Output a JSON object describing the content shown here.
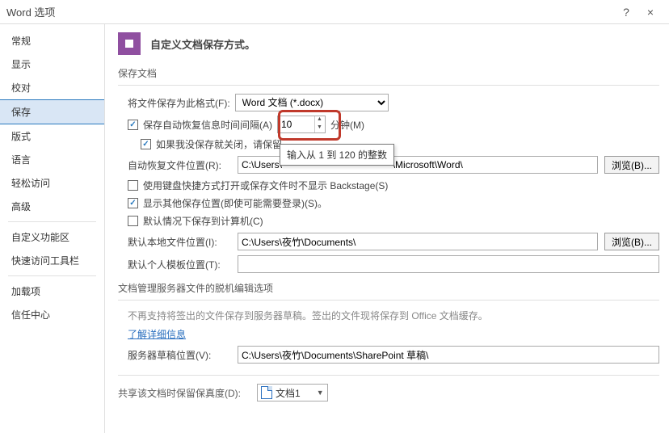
{
  "window": {
    "title": "Word 选项",
    "help": "?",
    "close": "×"
  },
  "sidebar": {
    "items": [
      "常规",
      "显示",
      "校对",
      "保存",
      "版式",
      "语言",
      "轻松访问",
      "高级"
    ],
    "items2": [
      "自定义功能区",
      "快速访问工具栏"
    ],
    "items3": [
      "加载项",
      "信任中心"
    ],
    "selected": "保存"
  },
  "header": {
    "title": "自定义文档保存方式。"
  },
  "section1": {
    "title": "保存文档",
    "format_label": "将文件保存为此格式(F):",
    "format_value": "Word 文档 (*.docx)",
    "autosave_cb_label": "保存自动恢复信息时间间隔(A)",
    "autosave_value": "10",
    "minutes_label": "分钟(M)",
    "keep_last_label": "如果我没保存就关闭，请保留",
    "tooltip": "输入从 1 到 120 的整数",
    "autorecover_label": "自动恢复文件位置(R):",
    "autorecover_path": "C:\\Users\\                                         \\Microsoft\\Word\\",
    "browse": "浏览(B)...",
    "hide_backstage_label": "使用键盘快捷方式打开或保存文件时不显示 Backstage(S)",
    "show_other_label": "显示其他保存位置(即使可能需要登录)(S)。",
    "default_pc_label": "默认情况下保存到计算机(C)",
    "local_label": "默认本地文件位置(I):",
    "local_path": "C:\\Users\\夜竹\\Documents\\",
    "template_label": "默认个人模板位置(T):",
    "template_path": ""
  },
  "section2": {
    "title": "文档管理服务器文件的脱机编辑选项",
    "note": "不再支持将签出的文件保存到服务器草稿。签出的文件现将保存到 Office 文档缓存。",
    "link": "了解详细信息",
    "draft_label": "服务器草稿位置(V):",
    "draft_path": "C:\\Users\\夜竹\\Documents\\SharePoint 草稿\\"
  },
  "section3": {
    "title": "共享该文档时保留保真度(D):",
    "doc_name": "文档1"
  }
}
